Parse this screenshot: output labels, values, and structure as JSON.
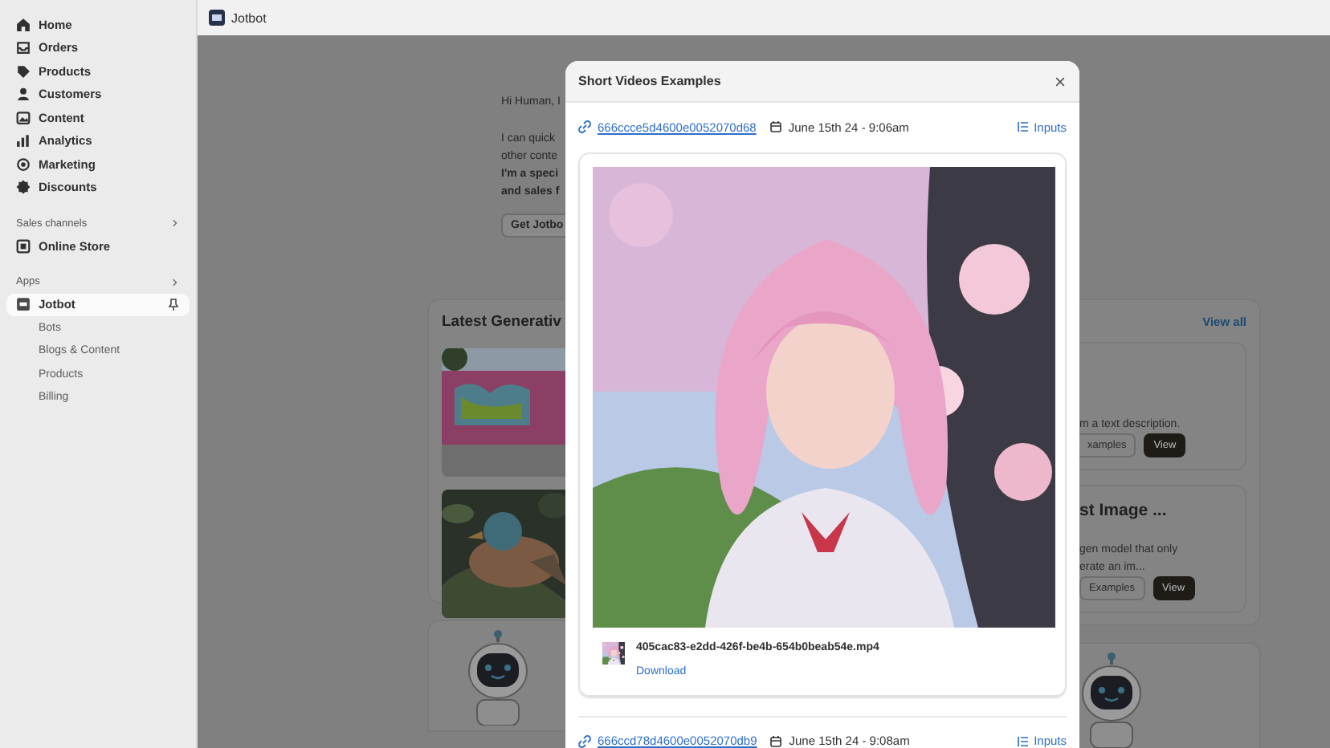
{
  "sidebar": {
    "nav": [
      {
        "label": "Home",
        "selected": false
      },
      {
        "label": "Orders",
        "selected": false
      },
      {
        "label": "Products",
        "selected": false
      },
      {
        "label": "Customers",
        "selected": false
      },
      {
        "label": "Content",
        "selected": false
      },
      {
        "label": "Analytics",
        "selected": false
      },
      {
        "label": "Marketing",
        "selected": false
      },
      {
        "label": "Discounts",
        "selected": false
      }
    ],
    "sales_channels": {
      "title": "Sales channels",
      "items": [
        {
          "label": "Online Store",
          "selected": false
        }
      ]
    },
    "apps": {
      "title": "Apps",
      "items": [
        {
          "label": "Jotbot",
          "selected": true,
          "children": [
            {
              "label": "Bots",
              "selected": false
            },
            {
              "label": "Blogs & Content",
              "selected": false
            },
            {
              "label": "Products",
              "selected": false
            },
            {
              "label": "Billing",
              "selected": false
            }
          ]
        }
      ]
    }
  },
  "top_bar": {
    "app_name": "Jotbot"
  },
  "background": {
    "greeting": "Hi Human, I",
    "intro_lines": [
      "I can quick",
      "other conte"
    ],
    "bold_lines": [
      "I'm a speci",
      "and sales f"
    ],
    "button": "Get Jotbo",
    "gallery": {
      "title": "Latest Generativ",
      "view_all": "View all",
      "cards": [
        {
          "description_lines": [
            "m a text description."
          ],
          "buttons": [
            "xamples",
            "View"
          ]
        },
        {
          "title": "st Image ...",
          "description_lines": [
            "gen model that only",
            "erate an im..."
          ],
          "buttons": [
            "Examples",
            "View"
          ]
        }
      ]
    }
  },
  "modal": {
    "title": "Short Videos Examples",
    "entries": [
      {
        "id": "666ccce5d4600e0052070d68",
        "date": "June 15th 24 - 9:06am",
        "inputs": "Inputs",
        "file": {
          "name": "405cac83-e2dd-426f-be4b-654b0beab54e.mp4",
          "action": "Download"
        }
      },
      {
        "id": "666ccd78d4600e0052070db9",
        "date": "June 15th 24 - 9:08am",
        "inputs": "Inputs"
      }
    ]
  }
}
